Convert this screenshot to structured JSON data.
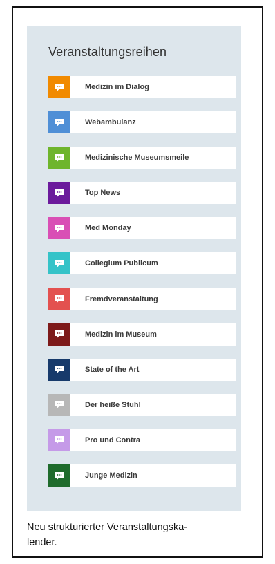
{
  "widget": {
    "title": "Veranstaltungsreihen",
    "items": [
      {
        "label": "Medizin im Dialog",
        "color": "#f18a00",
        "icon": "speech-bubble-icon"
      },
      {
        "label": "Webambulanz",
        "color": "#4f8fd6",
        "icon": "speech-bubble-icon"
      },
      {
        "label": "Medizinische Museumsmeile",
        "color": "#6eb52c",
        "icon": "speech-bubble-icon"
      },
      {
        "label": "Top News",
        "color": "#6b1a9c",
        "icon": "speech-bubble-icon"
      },
      {
        "label": "Med Monday",
        "color": "#d94fb5",
        "icon": "speech-bubble-icon"
      },
      {
        "label": "Collegium Publicum",
        "color": "#35c3c8",
        "icon": "speech-bubble-icon"
      },
      {
        "label": "Fremdveranstaltung",
        "color": "#e3514f",
        "icon": "speech-bubble-icon"
      },
      {
        "label": "Medizin im Museum",
        "color": "#7d1a1a",
        "icon": "speech-bubble-icon"
      },
      {
        "label": "State of the Art",
        "color": "#173a6b",
        "icon": "speech-bubble-icon"
      },
      {
        "label": "Der heiße Stuhl",
        "color": "#b7b7b7",
        "icon": "speech-bubble-icon"
      },
      {
        "label": "Pro und Contra",
        "color": "#c59ae8",
        "icon": "speech-bubble-icon"
      },
      {
        "label": "Junge Medizin",
        "color": "#1f6b2c",
        "icon": "speech-bubble-icon"
      }
    ]
  },
  "caption": "Neu strukturierter Veranstaltungska-\nlender."
}
